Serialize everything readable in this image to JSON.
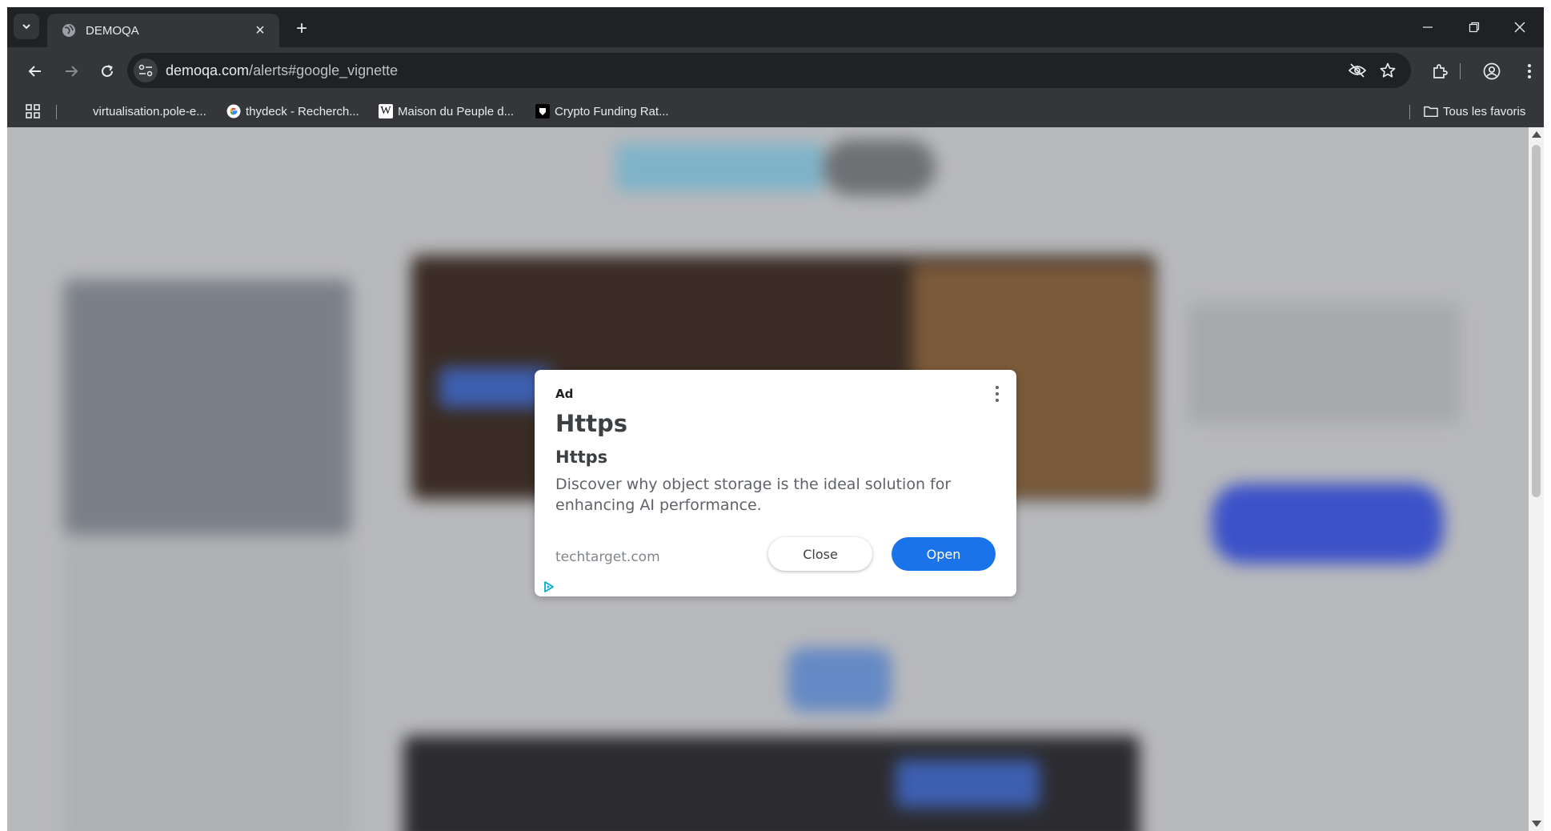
{
  "tab": {
    "title": "DEMOQA"
  },
  "address_bar": {
    "host": "demoqa.com",
    "path": "/alerts#google_vignette"
  },
  "bookmarks": {
    "items": [
      {
        "label": "virtualisation.pole-e..."
      },
      {
        "label": "thydeck - Recherch..."
      },
      {
        "label": "Maison du Peuple d..."
      },
      {
        "label": "Crypto Funding Rat..."
      }
    ],
    "all_bookmarks": "Tous les favoris"
  },
  "ad": {
    "label": "Ad",
    "title": "Https",
    "subtitle": "Https",
    "description": "Discover why object storage is the ideal solution for enhancing AI performance.",
    "domain": "techtarget.com",
    "close_label": "Close",
    "open_label": "Open"
  },
  "colors": {
    "chrome_dark": "#202124",
    "toolbar": "#35363a",
    "open_button": "#1a73e8",
    "overlay": "#b8b9bc"
  },
  "icons": [
    "tab-search-icon",
    "globe-icon",
    "close-icon",
    "plus-icon",
    "minimize-icon",
    "restore-icon",
    "back-icon",
    "forward-icon",
    "reload-icon",
    "site-info-icon",
    "eye-off-icon",
    "star-icon",
    "extensions-icon",
    "profile-icon",
    "more-vert-icon",
    "apps-icon",
    "google-icon",
    "wikipedia-icon",
    "folder-icon",
    "ad-choices-icon"
  ]
}
